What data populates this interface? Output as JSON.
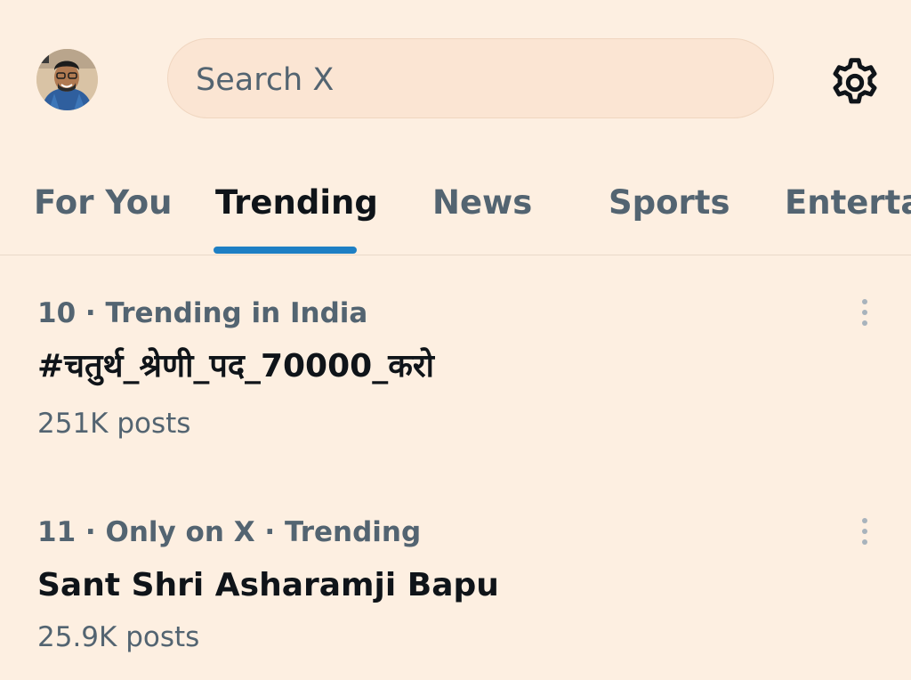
{
  "header": {
    "avatar_icon": "user-avatar",
    "search_placeholder": "Search X",
    "settings_icon": "gear-icon"
  },
  "tabs": [
    {
      "label": "For You",
      "active": false
    },
    {
      "label": "Trending",
      "active": true
    },
    {
      "label": "News",
      "active": false
    },
    {
      "label": "Sports",
      "active": false
    },
    {
      "label": "Entertai",
      "active": false
    }
  ],
  "trends": [
    {
      "meta": "10 · Trending in India",
      "title": "#चतुर्थ_श्रेणी_पद_70000_करो",
      "count": "251K posts"
    },
    {
      "meta": "11 · Only on X · Trending",
      "title": "Sant Shri Asharamji Bapu",
      "count": "25.9K posts"
    }
  ],
  "colors": {
    "background": "#fdefe1",
    "accent": "#1d7fc4",
    "secondary_text": "#536471",
    "primary_text": "#0f1419"
  }
}
